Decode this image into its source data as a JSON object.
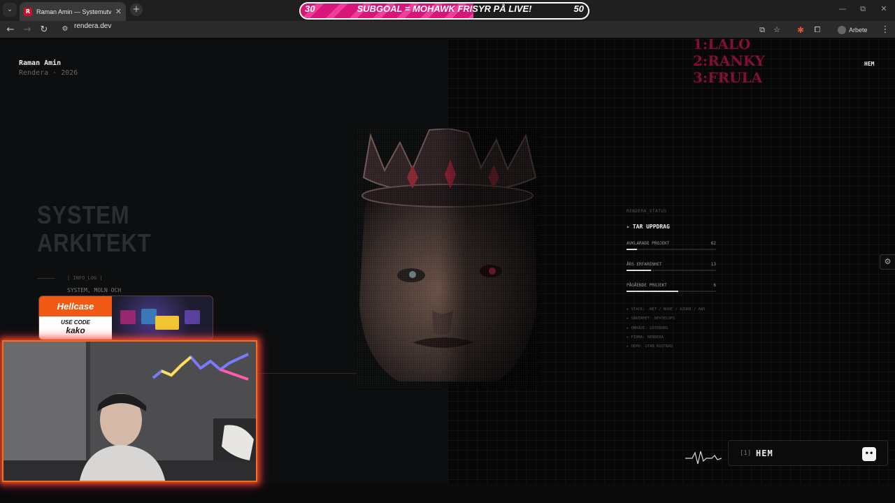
{
  "browser": {
    "tab": {
      "favicon": "R",
      "title": "Raman Amin — Systemutveckla",
      "close": "✕"
    },
    "new_tab": "+",
    "window_controls": [
      "—",
      "⧉",
      "✕"
    ],
    "address": {
      "url": "rendera.dev"
    },
    "profile_name": "Arbete"
  },
  "subgoal": {
    "current": "30",
    "target": "50",
    "label": "SUBGOAL = MOHAWK FRISYR PÅ LIVE!",
    "progress_fraction": 0.6,
    "colors": {
      "fill": "#d8157b",
      "stripe": "#ee3e98"
    }
  },
  "site": {
    "brand_name": "Raman Amin",
    "brand_sub": "Rendera · 2026",
    "nav_home": "HEM",
    "hero_title_line1": "SYSTEM",
    "hero_title_line2": "ARKITEKT",
    "info_log": "[ INFO_LOG ]",
    "info_text": "SYSTEM, MOLN OCH"
  },
  "ranking": [
    "1:LALO",
    "2:RANKY",
    "3:FRULA"
  ],
  "status_panel": {
    "label": "RENDERA_STATUS",
    "headline": "TAR UPPDRAG",
    "headline_marker": "▸",
    "stats": [
      {
        "label": "AVKLARADE PROJEKT",
        "value": "62",
        "fraction": 0.12
      },
      {
        "label": "ÅRS ERFARENHET",
        "value": "13",
        "fraction": 0.27
      },
      {
        "label": "PÅGÅENDE PROJEKT",
        "value": "6",
        "fraction": 0.58
      }
    ],
    "meta": [
      "▸ STACK: .NET / NODE / AZURE / AWS",
      "▸ SÄKERHET: DEVSECOPS",
      "▸ OMRÅDE: GÖTEBORG",
      "▸ FIRMA: RENDERA",
      "▸ DEMO: UTAN KOSTNAD"
    ]
  },
  "command_bar": {
    "index": "[1]",
    "label": "HEM",
    "button_glyph": "••"
  },
  "sponsor": {
    "brand": "Hellcase",
    "code_label": "USE CODE",
    "code_value": "kako",
    "brand_color": "#f05a14"
  },
  "colors": {
    "accent_pink": "#e8125e",
    "webcam_border": "#ff6a1a"
  }
}
